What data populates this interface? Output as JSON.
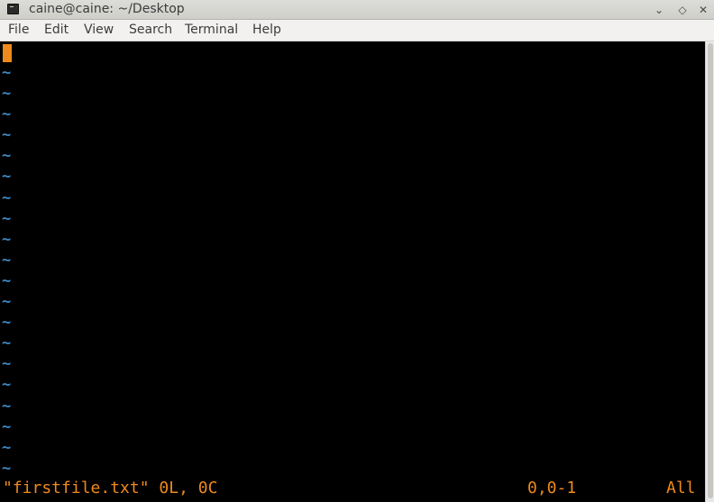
{
  "window": {
    "title": "caine@caine: ~/Desktop",
    "icon": "terminal-icon",
    "controls": {
      "minimize": "⌄",
      "maximize": "◇",
      "close": "✕"
    }
  },
  "menu": {
    "file": "File",
    "edit": "Edit",
    "view": "View",
    "search": "Search",
    "terminal": "Terminal",
    "help": "Help"
  },
  "editor": {
    "empty_line_marker": "~",
    "status_file": "\"firstfile.txt\" 0L, 0C",
    "status_position": "0,0-1",
    "status_scroll": "All"
  },
  "colors": {
    "background": "#000000",
    "cursor": "#ee8a1d",
    "tilde": "#3b88c4",
    "status_text": "#ee8a1d"
  }
}
